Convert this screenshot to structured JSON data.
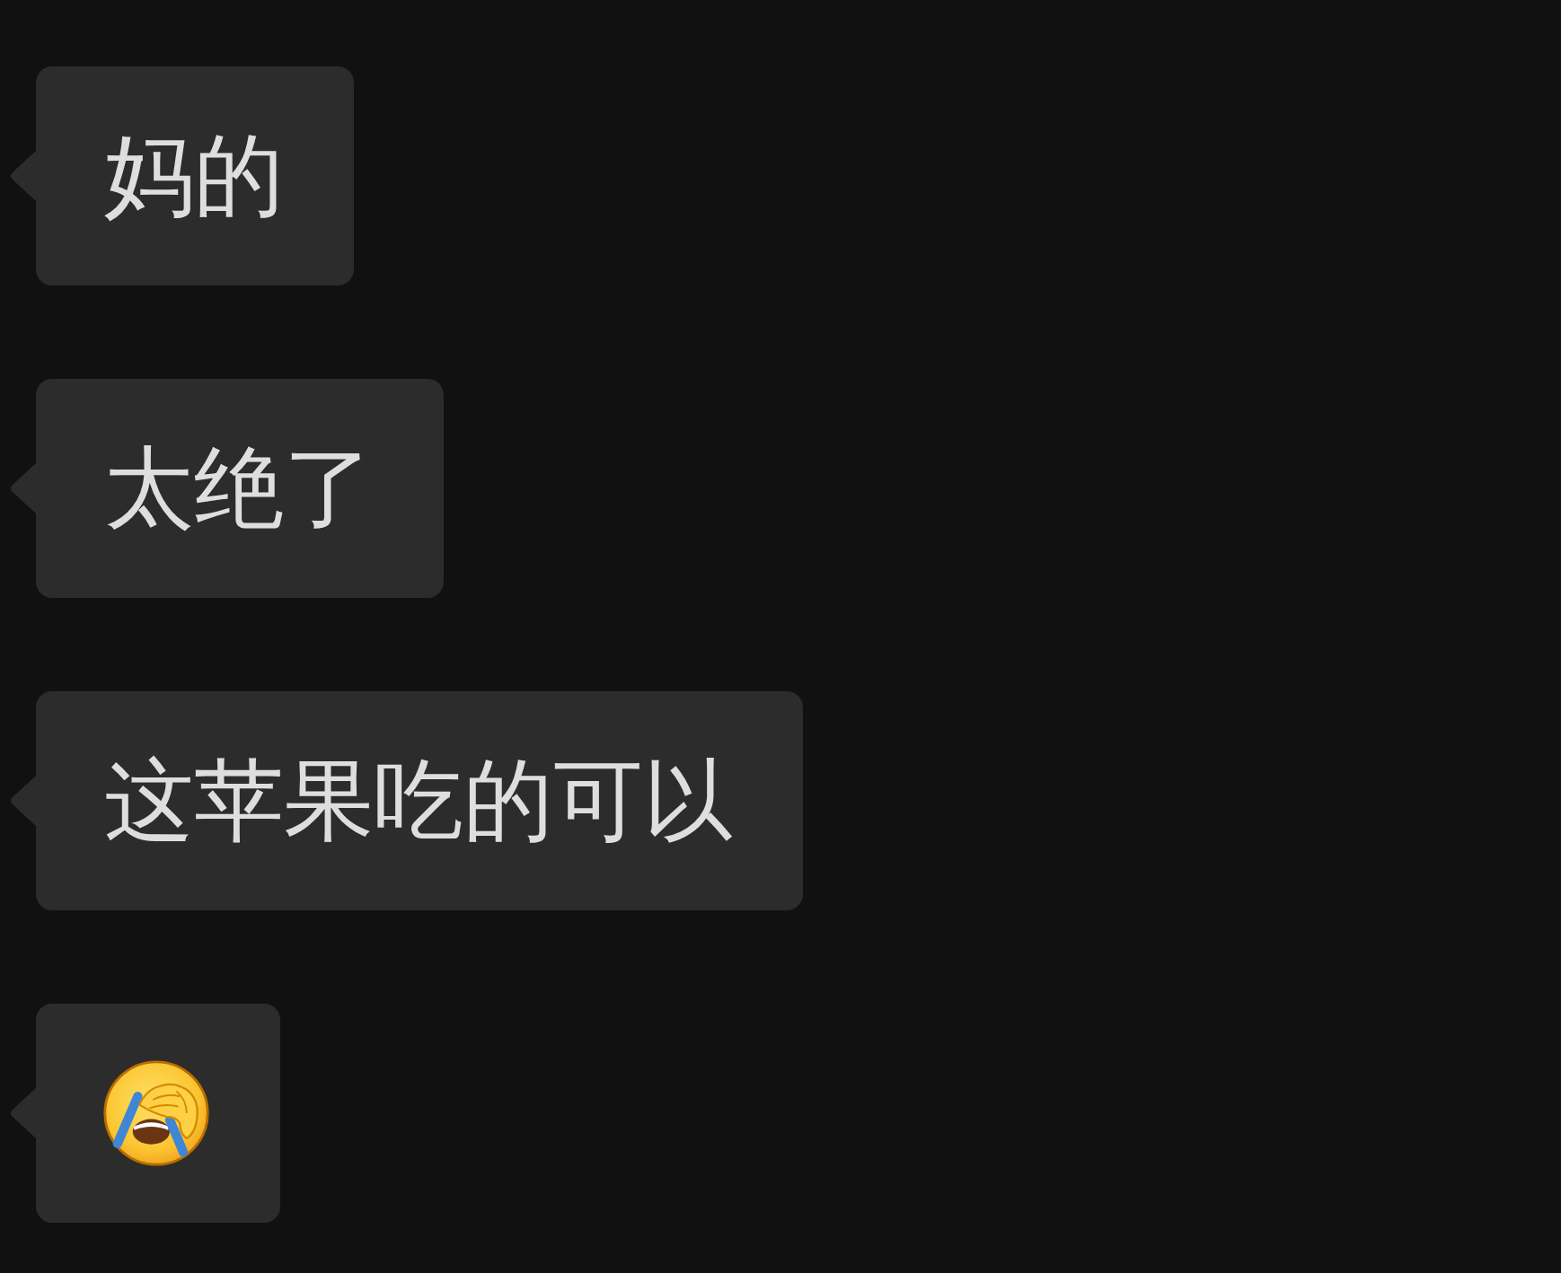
{
  "chat": {
    "messages": [
      {
        "kind": "text",
        "text": "妈的"
      },
      {
        "kind": "text",
        "text": "太绝了"
      },
      {
        "kind": "text",
        "text": "这苹果吃的可以"
      },
      {
        "kind": "emoji"
      }
    ]
  }
}
